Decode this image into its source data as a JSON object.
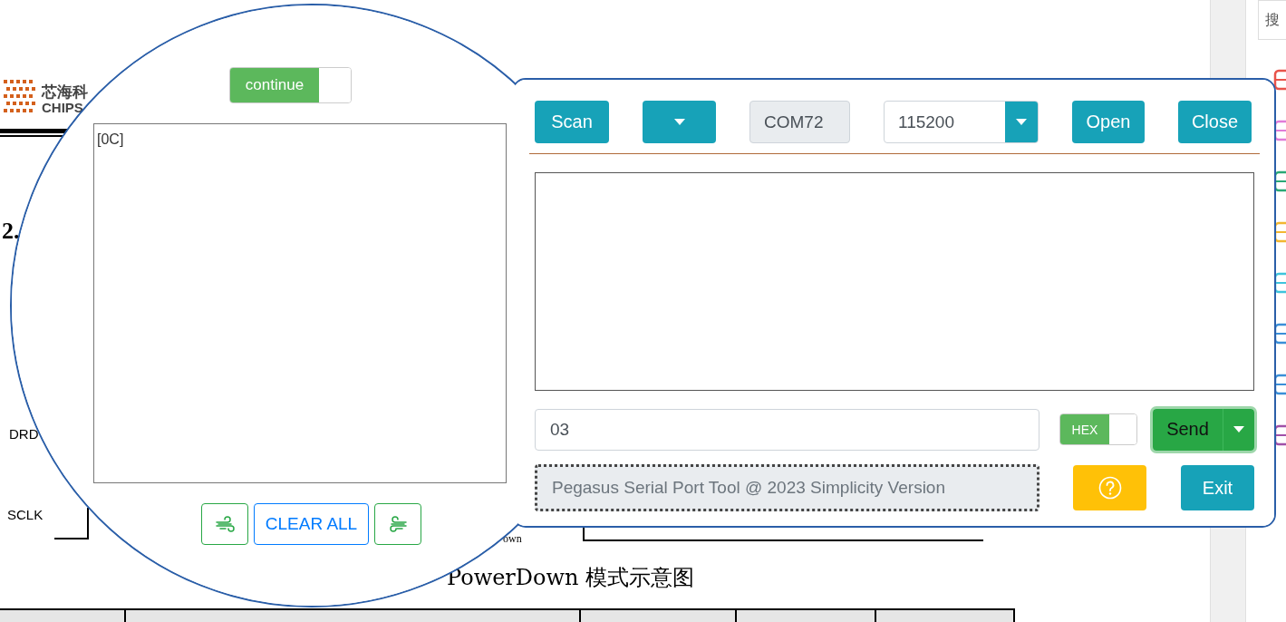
{
  "document": {
    "logo_cn": "芯海科",
    "logo_en": "CHIPS",
    "heading": "2.",
    "signals": [
      "DRD",
      "SCLK"
    ],
    "diagram_label": "own",
    "caption": "PowerDown 模式示意图",
    "search_hint": "搜"
  },
  "monitor": {
    "pause_toggle": {
      "label": "continue",
      "on": true
    },
    "output": "[0C]",
    "clear_button": "CLEAR ALL"
  },
  "port_bar": {
    "scan": "Scan",
    "port": {
      "value": "COM72",
      "disabled": true
    },
    "baud": "115200",
    "open": "Open",
    "close": "Close"
  },
  "send_row": {
    "input": "03",
    "hex_toggle": {
      "label": "HEX",
      "on": true
    },
    "send": "Send"
  },
  "status": "Pegasus Serial Port Tool @ 2023 Simplicity Version",
  "exit": "Exit"
}
